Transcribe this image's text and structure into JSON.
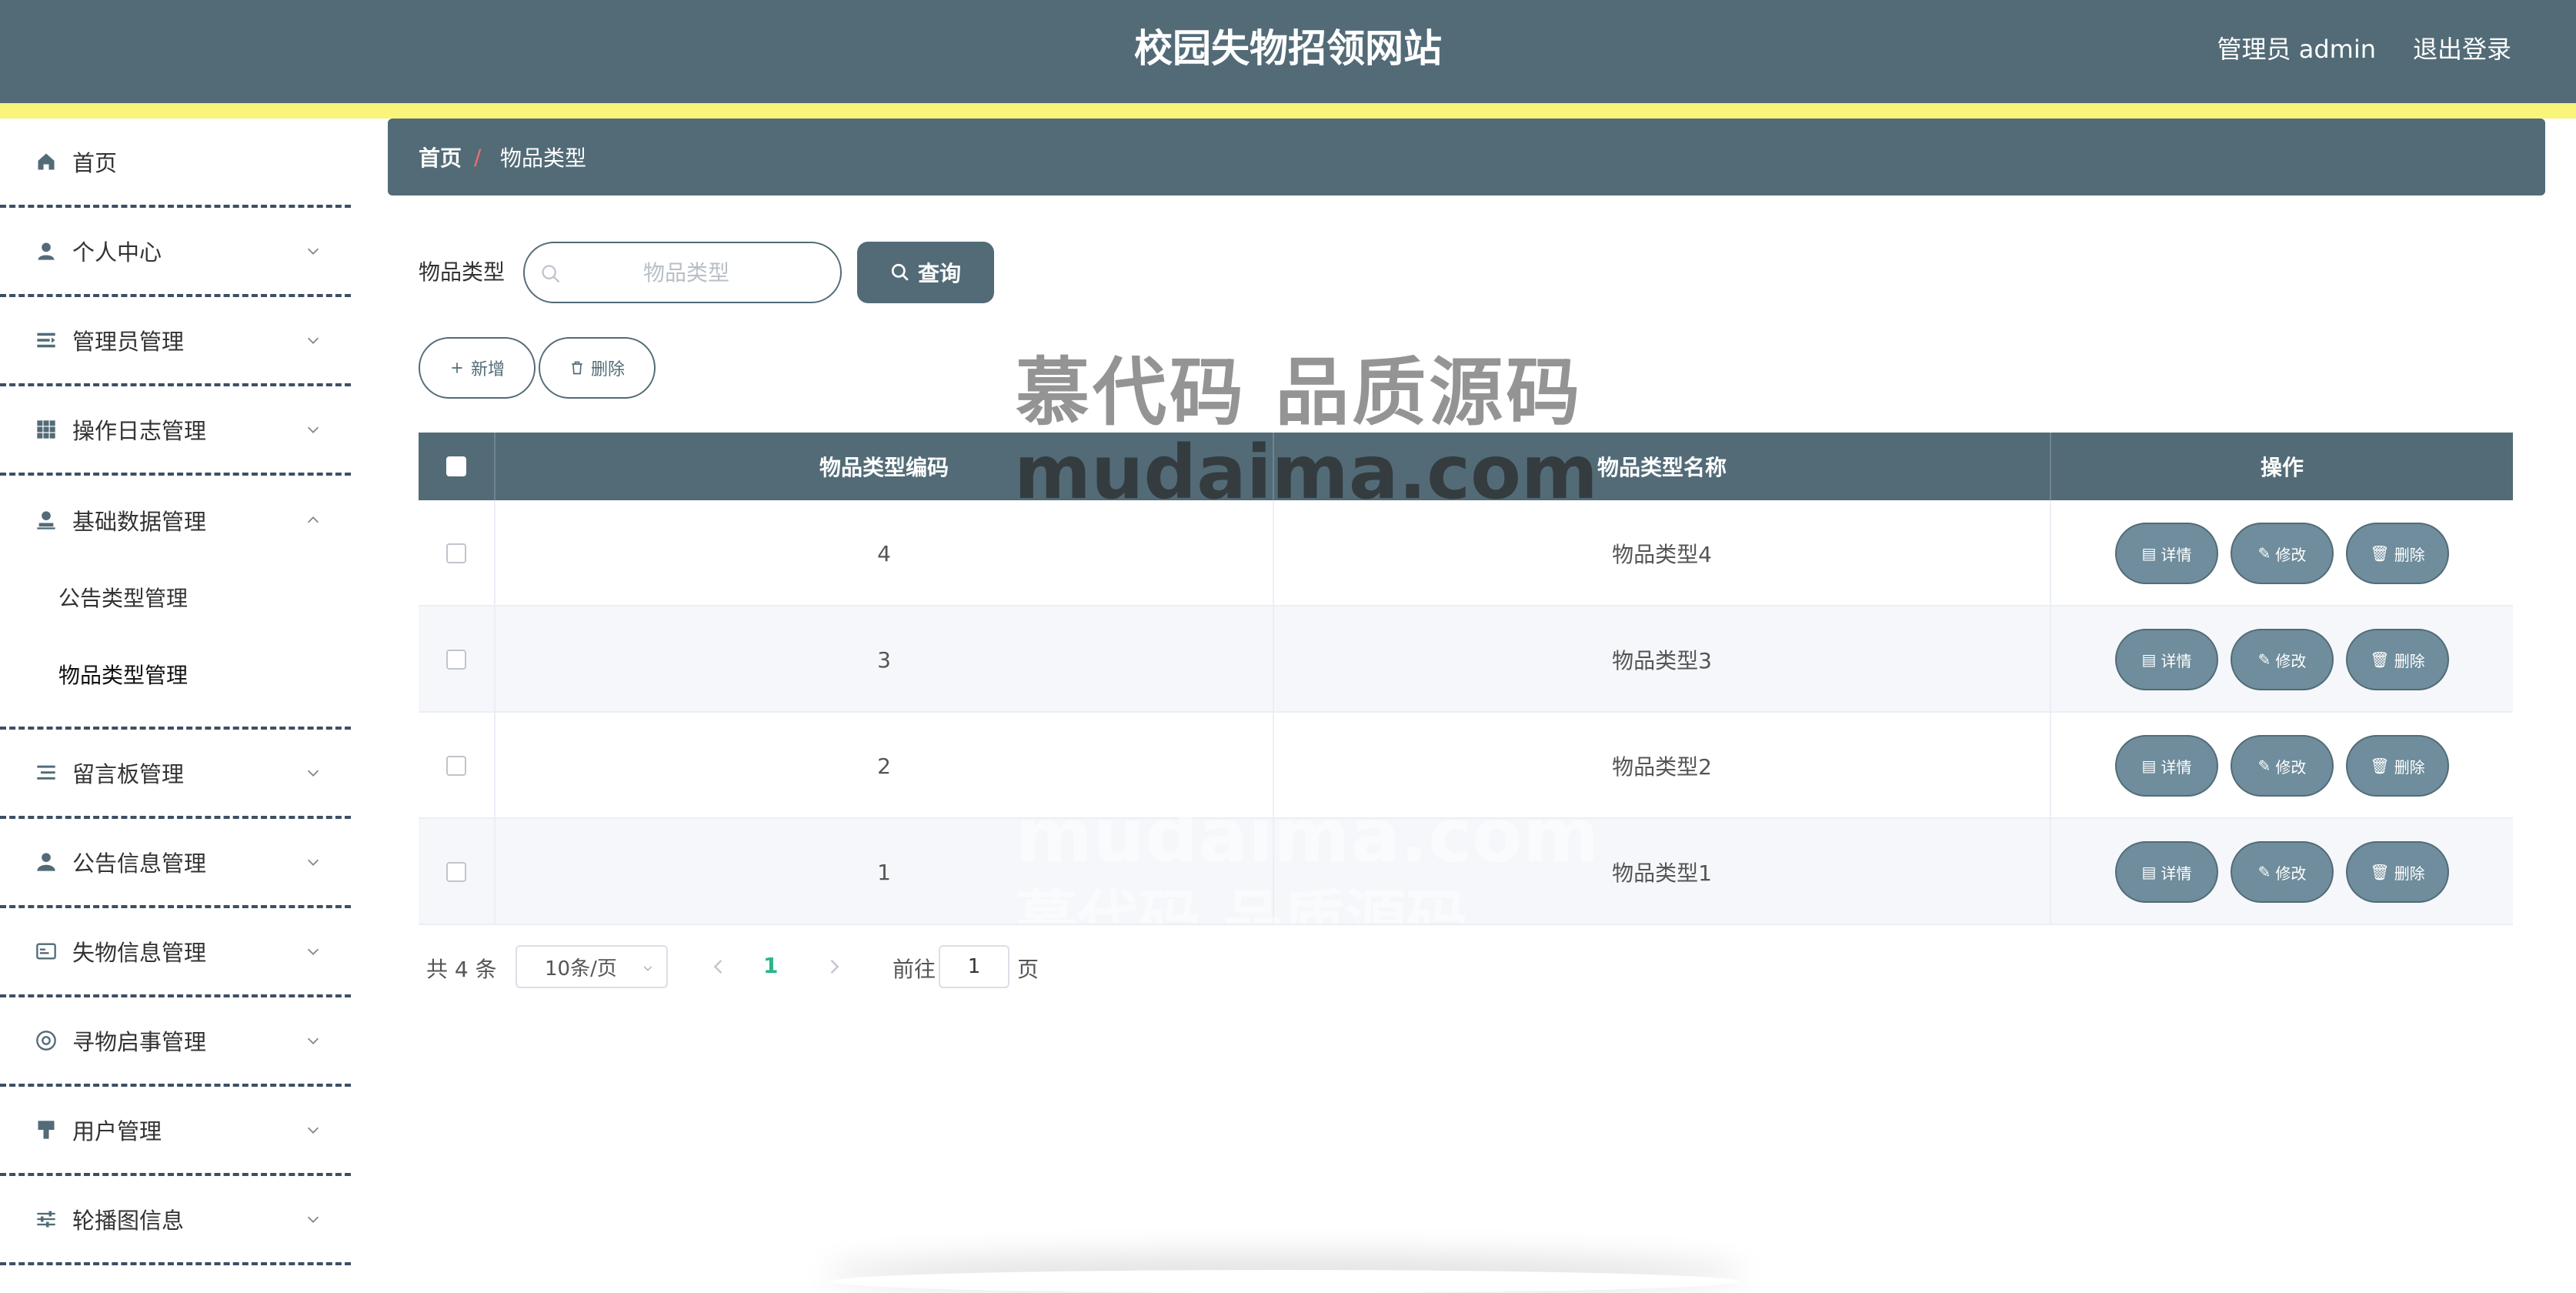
{
  "header": {
    "site_title": "校园失物招领网站",
    "user_label": "管理员 admin",
    "logout_label": "退出登录"
  },
  "sidebar": {
    "items": [
      {
        "label": "首页",
        "icon": "home-icon"
      },
      {
        "label": "个人中心",
        "icon": "user-icon"
      },
      {
        "label": "管理员管理",
        "icon": "list-icon"
      },
      {
        "label": "操作日志管理",
        "icon": "grid-icon"
      },
      {
        "label": "基础数据管理",
        "icon": "stamp-icon"
      },
      {
        "label": "留言板管理",
        "icon": "lines-icon"
      },
      {
        "label": "公告信息管理",
        "icon": "person-icon"
      },
      {
        "label": "失物信息管理",
        "icon": "card-icon"
      },
      {
        "label": "寻物启事管理",
        "icon": "lifebuoy-icon"
      },
      {
        "label": "用户管理",
        "icon": "brush-icon"
      },
      {
        "label": "轮播图信息",
        "icon": "sliders-icon"
      }
    ],
    "sub_items": [
      "公告类型管理",
      "物品类型管理"
    ]
  },
  "breadcrumb": {
    "home": "首页",
    "separator": "/",
    "current": "物品类型"
  },
  "search": {
    "label": "物品类型",
    "placeholder": "物品类型",
    "value": "",
    "query_label": "查询"
  },
  "actions": {
    "add_label": "新增",
    "delete_label": "删除"
  },
  "table": {
    "columns": [
      "物品类型编码",
      "物品类型名称",
      "操作"
    ],
    "rows": [
      {
        "code": "4",
        "name": "物品类型4"
      },
      {
        "code": "3",
        "name": "物品类型3"
      },
      {
        "code": "2",
        "name": "物品类型2"
      },
      {
        "code": "1",
        "name": "物品类型1"
      }
    ],
    "row_actions": {
      "detail": "详情",
      "edit": "修改",
      "delete": "删除"
    }
  },
  "pagination": {
    "total": "共 4 条",
    "page_size": "10条/页",
    "current_page": "1",
    "goto_label": "前往",
    "goto_value": "1",
    "page_suffix": "页"
  },
  "watermark": {
    "zh": "慕代码 品质源码",
    "en": "mudaima.com"
  },
  "colors": {
    "primary": "#526b77",
    "accent_strip": "#f9f47a",
    "row_button": "#6f8d9c",
    "active_page": "#2bb48a",
    "breadcrumb_separator": "#f56c6c"
  }
}
